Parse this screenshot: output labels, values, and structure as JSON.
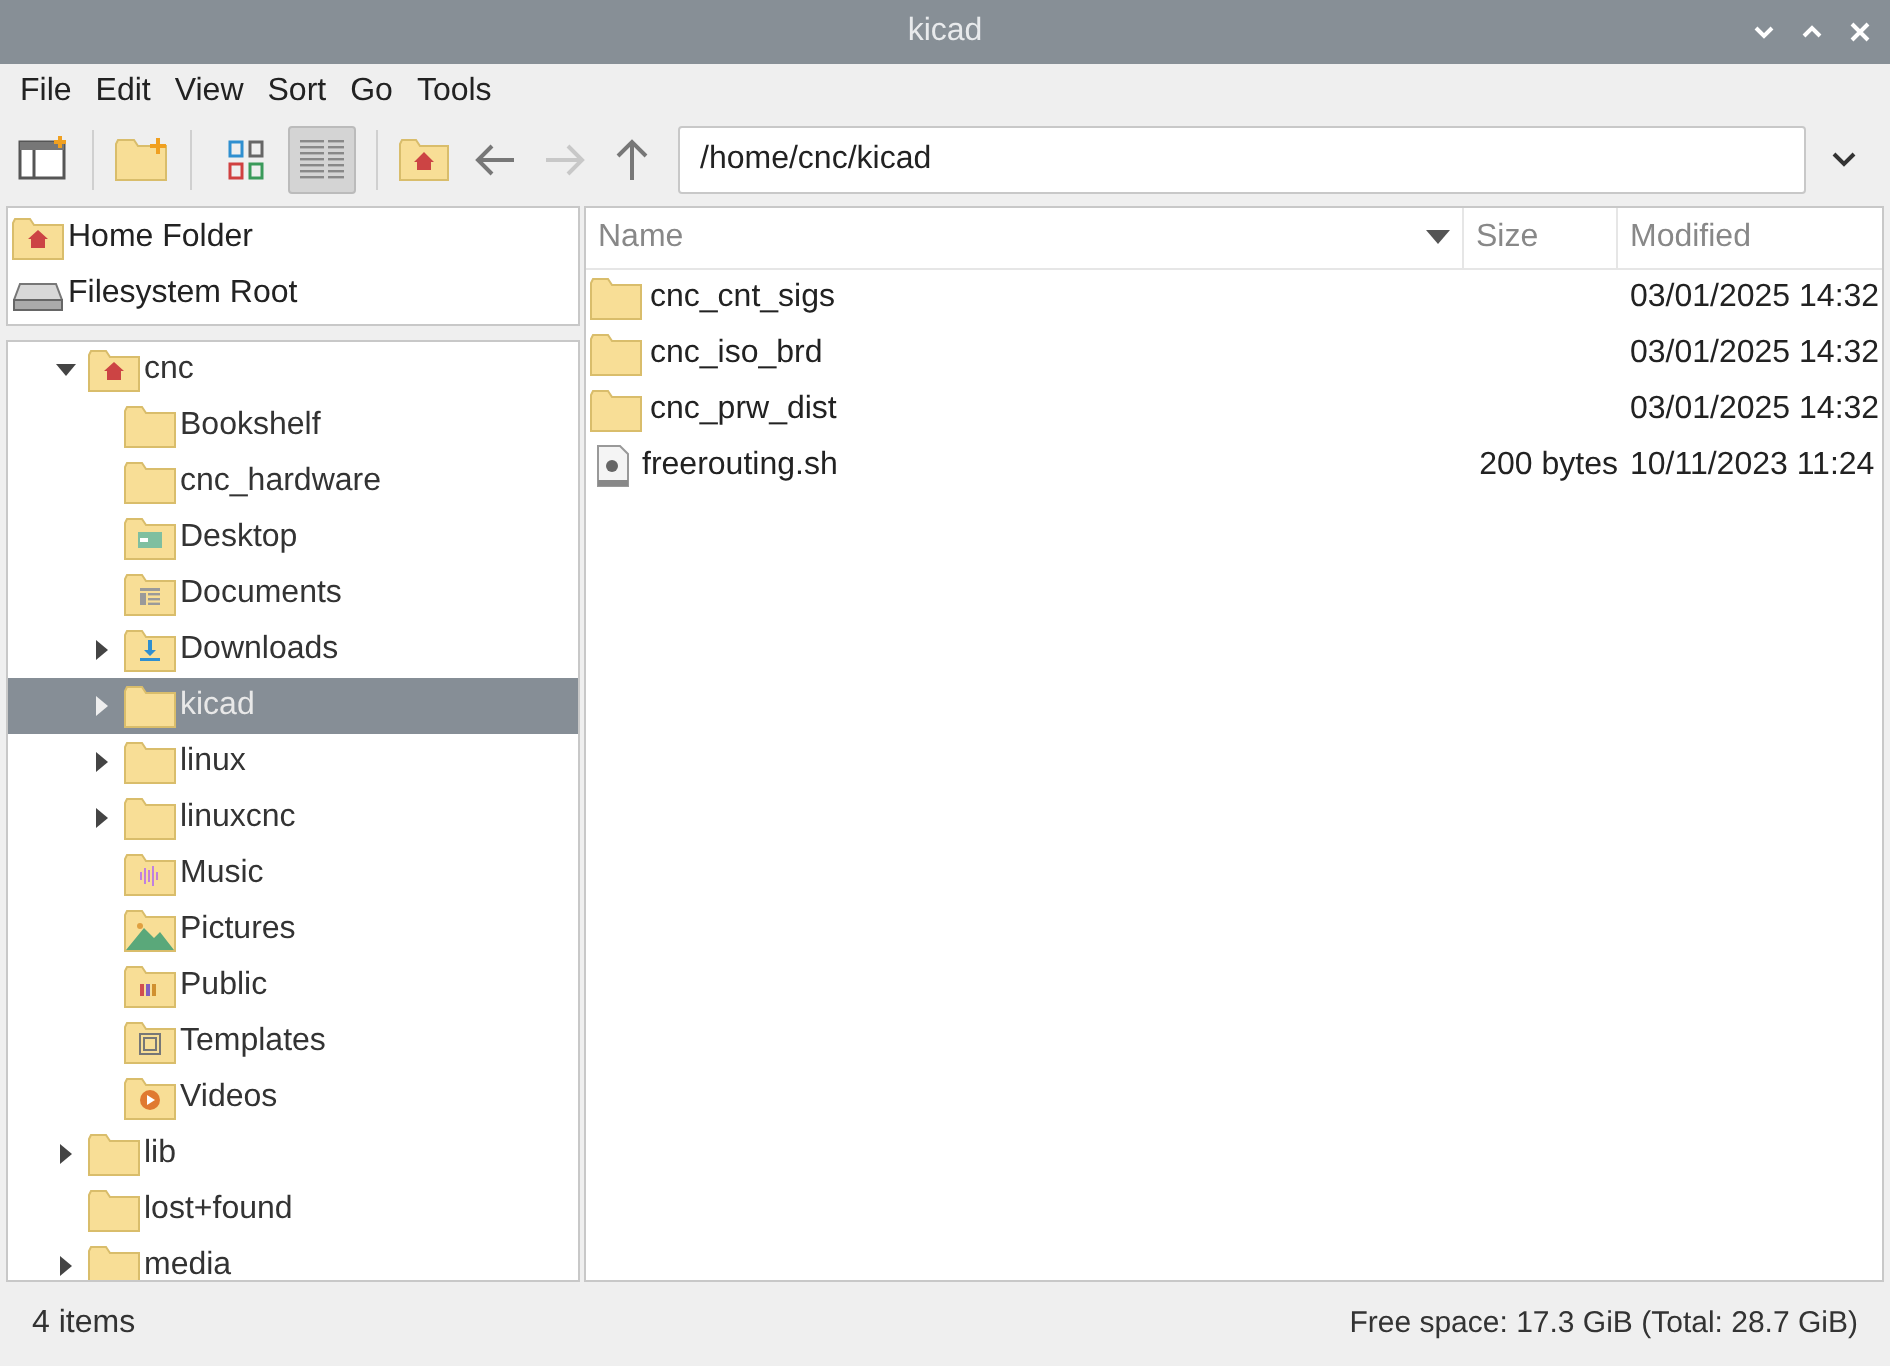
{
  "window": {
    "title": "kicad"
  },
  "menu": [
    "File",
    "Edit",
    "View",
    "Sort",
    "Go",
    "Tools"
  ],
  "toolbar": {
    "view_modes": [
      {
        "kind": "icons",
        "selected": false
      },
      {
        "kind": "list",
        "selected": true
      }
    ],
    "back_disabled": false,
    "forward_disabled": true,
    "path": "/home/cnc/kicad"
  },
  "places": [
    {
      "label": "Home Folder",
      "kind": "home"
    },
    {
      "label": "Filesystem Root",
      "kind": "drive"
    }
  ],
  "tree": [
    {
      "label": "cnc",
      "kind": "home",
      "has_children": true,
      "expanded": true,
      "selected": false,
      "children": [
        {
          "label": "Bookshelf",
          "kind": "folder",
          "has_children": false,
          "expanded": false,
          "selected": false
        },
        {
          "label": "cnc_hardware",
          "kind": "folder",
          "has_children": false,
          "expanded": false,
          "selected": false
        },
        {
          "label": "Desktop",
          "kind": "desktop",
          "has_children": false,
          "expanded": false,
          "selected": false
        },
        {
          "label": "Documents",
          "kind": "documents",
          "has_children": false,
          "expanded": false,
          "selected": false
        },
        {
          "label": "Downloads",
          "kind": "downloads",
          "has_children": true,
          "expanded": false,
          "selected": false
        },
        {
          "label": "kicad",
          "kind": "folder",
          "has_children": true,
          "expanded": false,
          "selected": true
        },
        {
          "label": "linux",
          "kind": "folder",
          "has_children": true,
          "expanded": false,
          "selected": false
        },
        {
          "label": "linuxcnc",
          "kind": "folder",
          "has_children": true,
          "expanded": false,
          "selected": false
        },
        {
          "label": "Music",
          "kind": "music",
          "has_children": false,
          "expanded": false,
          "selected": false
        },
        {
          "label": "Pictures",
          "kind": "pictures",
          "has_children": false,
          "expanded": false,
          "selected": false
        },
        {
          "label": "Public",
          "kind": "public",
          "has_children": false,
          "expanded": false,
          "selected": false
        },
        {
          "label": "Templates",
          "kind": "templates",
          "has_children": false,
          "expanded": false,
          "selected": false
        },
        {
          "label": "Videos",
          "kind": "videos",
          "has_children": false,
          "expanded": false,
          "selected": false
        }
      ]
    },
    {
      "label": "lib",
      "kind": "folder",
      "has_children": true,
      "expanded": false,
      "selected": false
    },
    {
      "label": "lost+found",
      "kind": "folder",
      "has_children": false,
      "expanded": false,
      "selected": false
    },
    {
      "label": "media",
      "kind": "folder",
      "has_children": true,
      "expanded": false,
      "selected": false
    }
  ],
  "table": {
    "columns": [
      "Name",
      "Size",
      "Modified"
    ],
    "rows": [
      {
        "name": "cnc_cnt_sigs",
        "kind": "folder",
        "size": "",
        "modified": "03/01/2025 14:32"
      },
      {
        "name": "cnc_iso_brd",
        "kind": "folder",
        "size": "",
        "modified": "03/01/2025 14:32"
      },
      {
        "name": "cnc_prw_dist",
        "kind": "folder",
        "size": "",
        "modified": "03/01/2025 14:32"
      },
      {
        "name": "freerouting.sh",
        "kind": "script",
        "size": "200 bytes",
        "modified": "10/11/2023 11:24"
      }
    ]
  },
  "status_bar": {
    "count": "4 items",
    "free_space": "Free space: 17.3 GiB (Total: 28.7 GiB)"
  }
}
